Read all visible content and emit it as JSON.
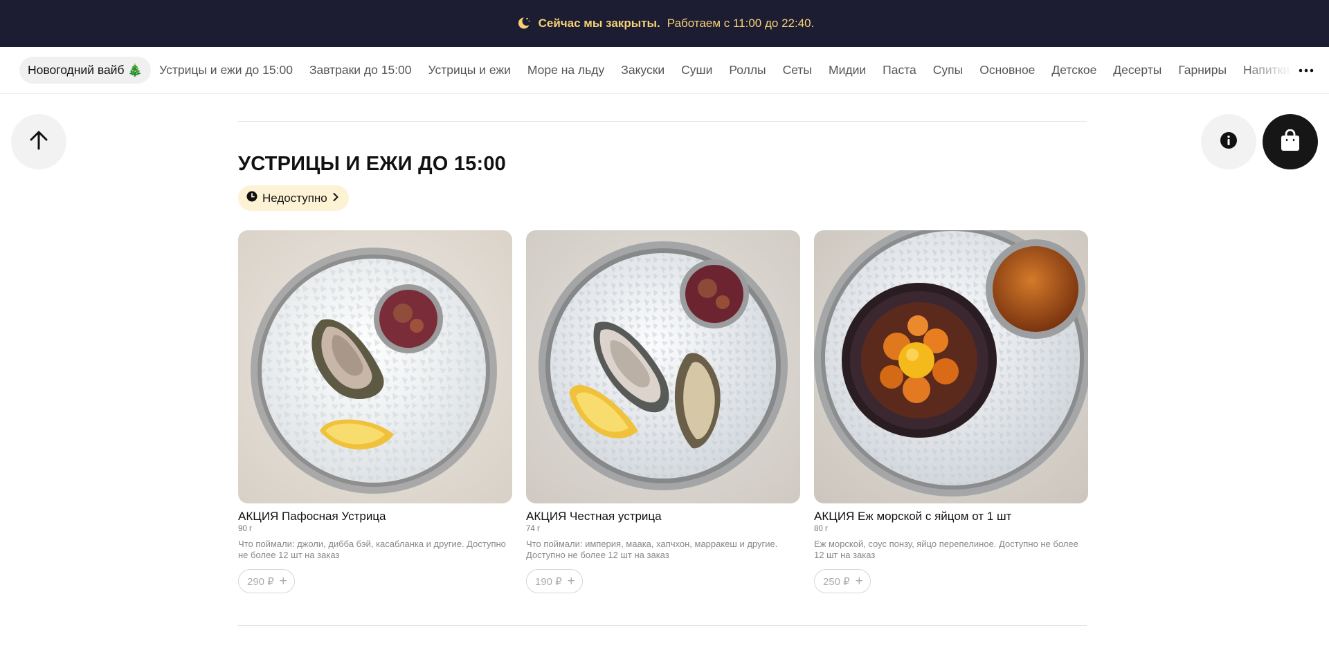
{
  "banner": {
    "bold": "Сейчас мы закрыты.",
    "text": "Работаем с 11:00 до 22:40.",
    "icon": "moon-icon"
  },
  "categories": [
    "Новогодний вайб 🎄",
    "Устрицы и ежи до 15:00",
    "Завтраки до 15:00",
    "Устрицы и ежи",
    "Море на льду",
    "Закуски",
    "Суши",
    "Роллы",
    "Сеты",
    "Мидии",
    "Паста",
    "Супы",
    "Основное",
    "Детское",
    "Десерты",
    "Гарниры",
    "Напитки"
  ],
  "section": {
    "title": "УСТРИЦЫ И ЕЖИ ДО 15:00",
    "status": "Недоступно"
  },
  "products": [
    {
      "name": "АКЦИЯ Пафосная Устрица",
      "weight": "90 г",
      "description": "Что поймали: джоли, дибба бэй, касабланка и другие. Доступно не более 12 шт на заказ",
      "price": "290 ₽"
    },
    {
      "name": "АКЦИЯ Честная устрица",
      "weight": "74 г",
      "description": "Что поймали: империя, маака, хапчхон, марракеш и другие. Доступно не более 12 шт на заказ",
      "price": "190 ₽"
    },
    {
      "name": "АКЦИЯ Еж морской с яйцом от 1 шт",
      "weight": "80 г",
      "description": "Еж морской, соус понзу, яйцо перепелиное. Доступно не более 12 шт на заказ",
      "price": "250 ₽"
    }
  ],
  "colors": {
    "banner_bg": "#1c1d33",
    "banner_text": "#f7d174",
    "cart_bg": "#161616",
    "status_bg": "#fdf3d4"
  }
}
